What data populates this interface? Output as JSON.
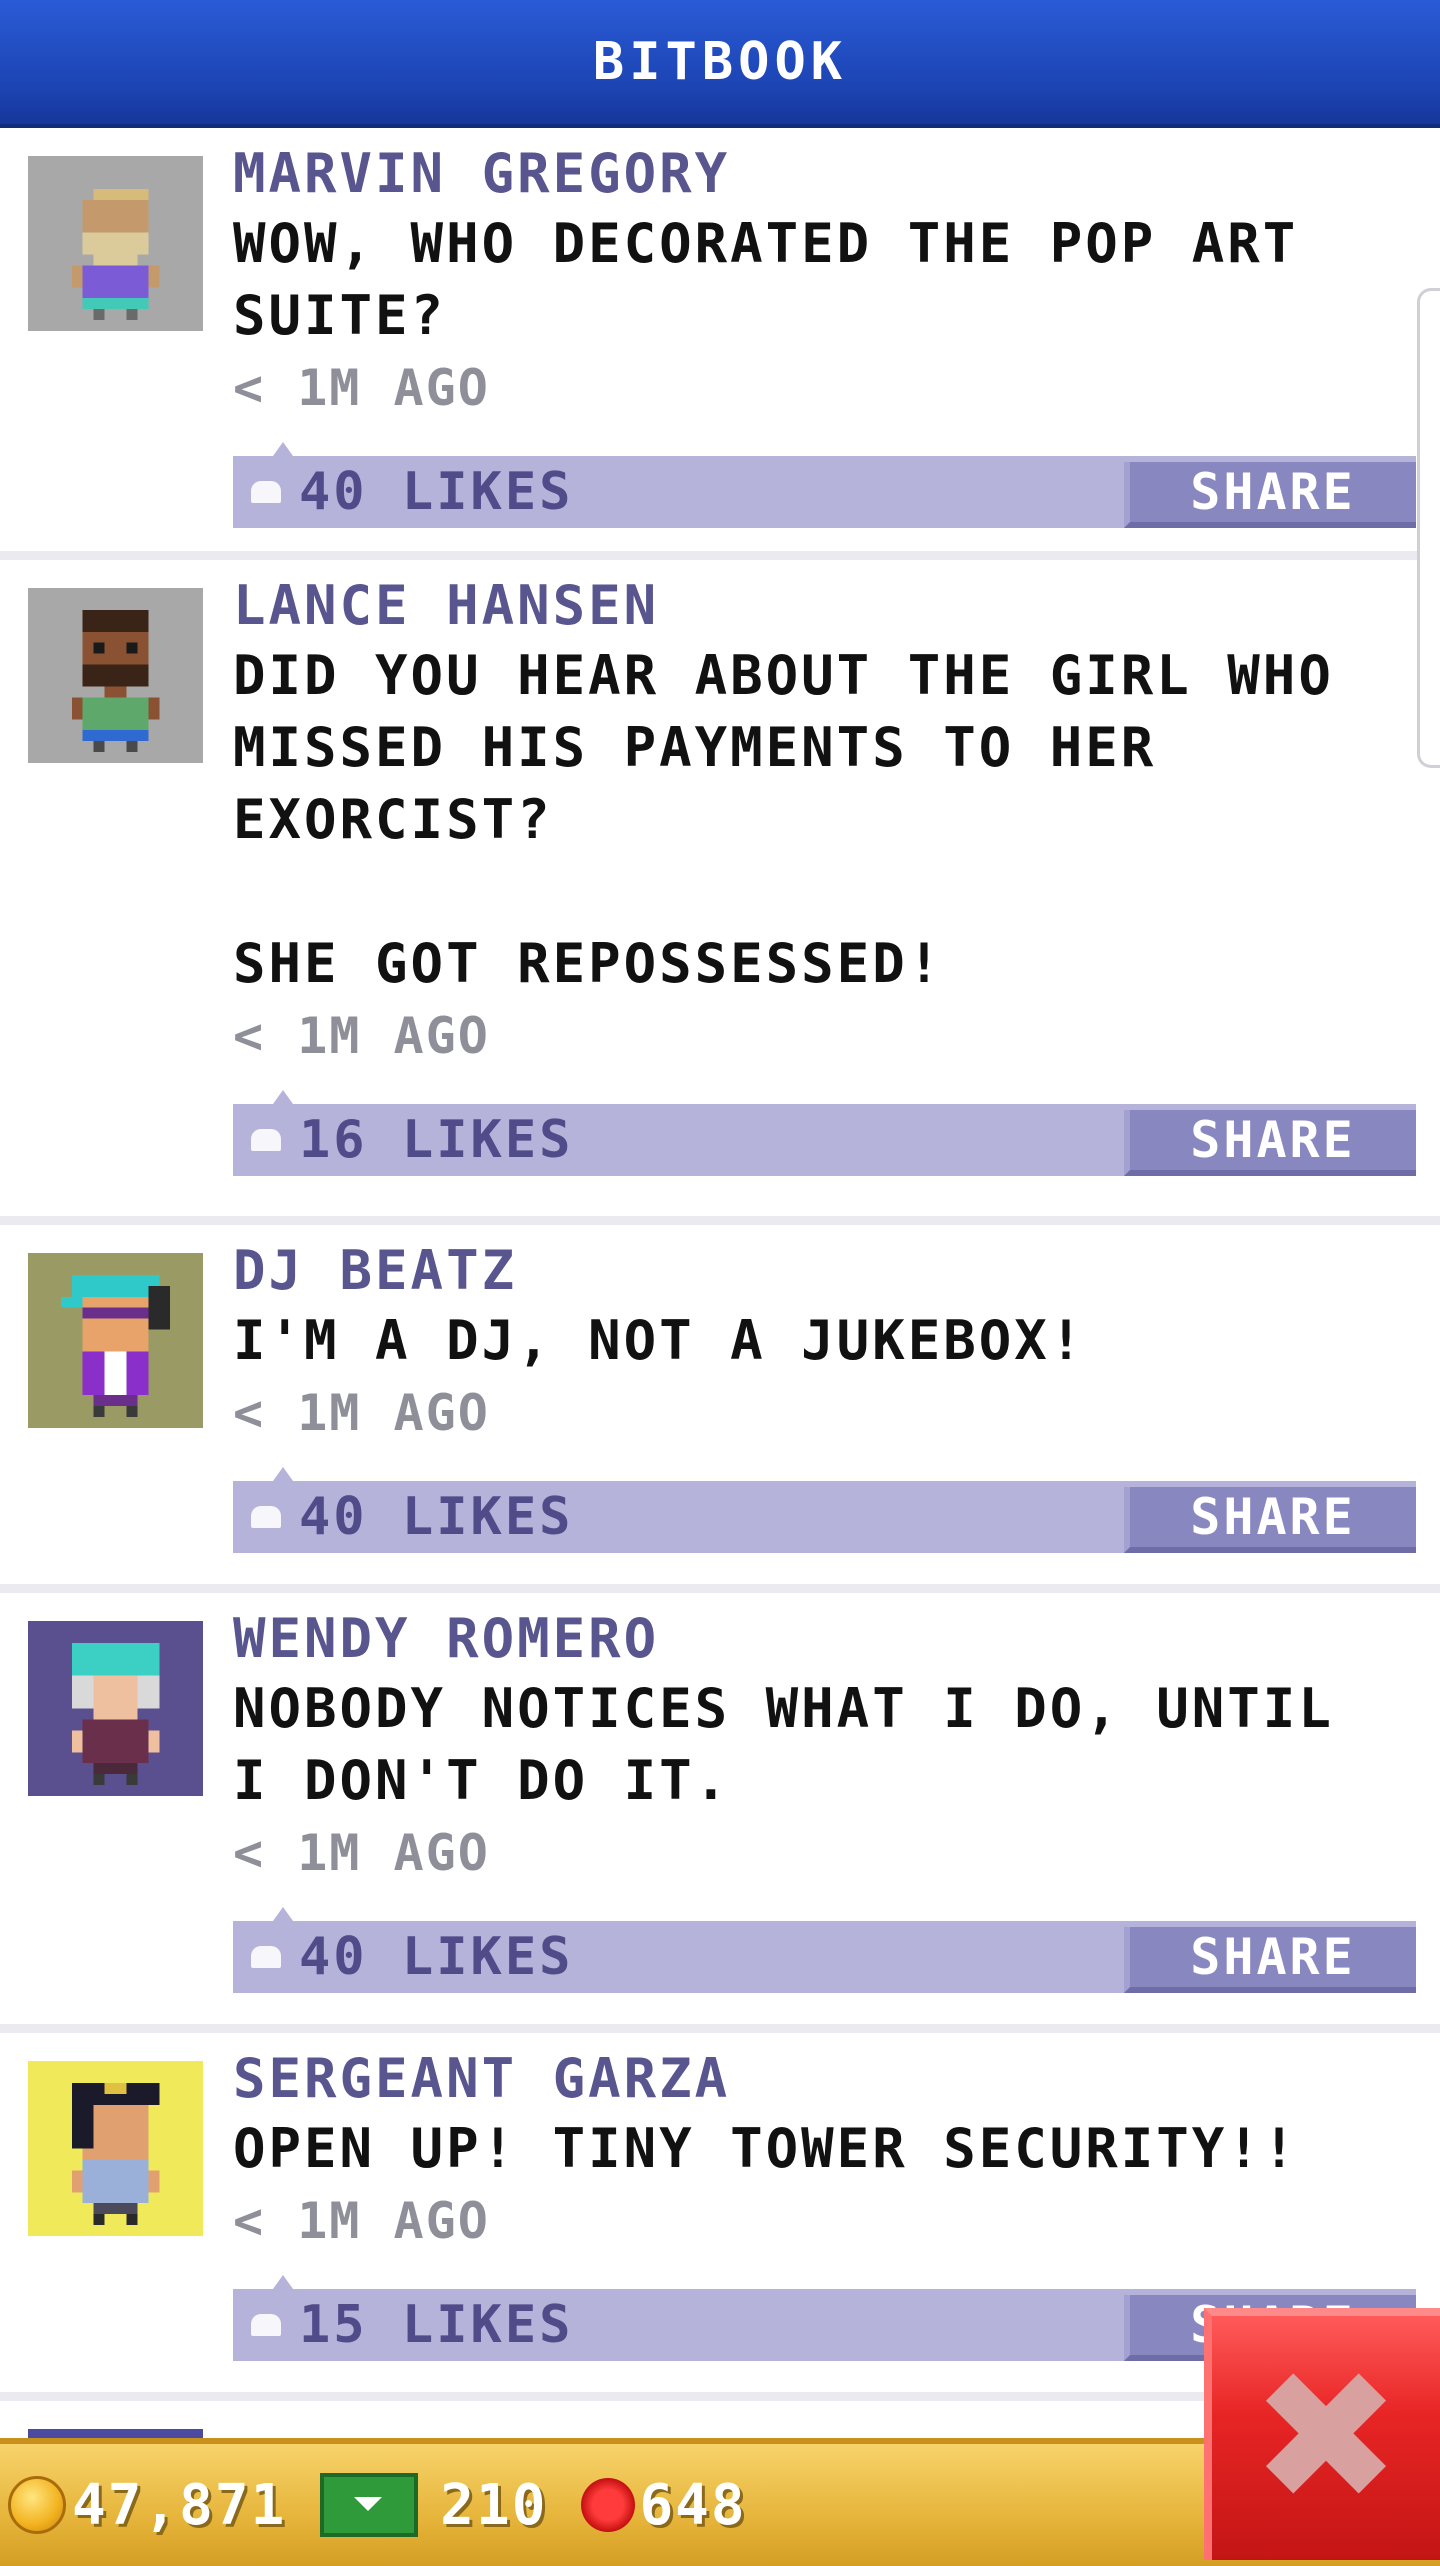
{
  "header": {
    "title": "BITBOOK"
  },
  "posts": [
    {
      "author": "MARVIN GREGORY",
      "message": "WOW, WHO DECORATED THE POP ART SUITE?",
      "time": "< 1M AGO",
      "likes": "40 LIKES",
      "share": "SHARE"
    },
    {
      "author": "LANCE HANSEN",
      "message": "DID YOU HEAR ABOUT THE GIRL WHO MISSED HIS PAYMENTS TO HER EXORCIST?\n\nSHE GOT REPOSSESSED!",
      "time": "< 1M AGO",
      "likes": "16 LIKES",
      "share": "SHARE"
    },
    {
      "author": "DJ BEATZ",
      "message": "I'M A DJ, NOT A JUKEBOX!",
      "time": "< 1M AGO",
      "likes": "40 LIKES",
      "share": "SHARE"
    },
    {
      "author": "WENDY ROMERO",
      "message": "NOBODY NOTICES WHAT I DO, UNTIL I DON'T DO IT.",
      "time": "< 1M AGO",
      "likes": "40 LIKES",
      "share": "SHARE"
    },
    {
      "author": "SERGEANT GARZA",
      "message": "OPEN UP! TINY TOWER SECURITY!!",
      "time": "< 1M AGO",
      "likes": "15 LIKES",
      "share": "SHARE"
    }
  ],
  "footer": {
    "coins": "47,871",
    "bux": "210",
    "gems": "648"
  },
  "colors": {
    "header": "#1c44b3",
    "likes_bar": "#b5b3da",
    "share_button": "#8987c0",
    "author": "#58558f",
    "footer": "#e6b53b",
    "close": "#e82525"
  },
  "icons": {
    "like": "thumbs-up-icon",
    "coin": "coin-icon",
    "bux": "bux-icon",
    "gem": "gem-icon",
    "close": "close-icon"
  }
}
